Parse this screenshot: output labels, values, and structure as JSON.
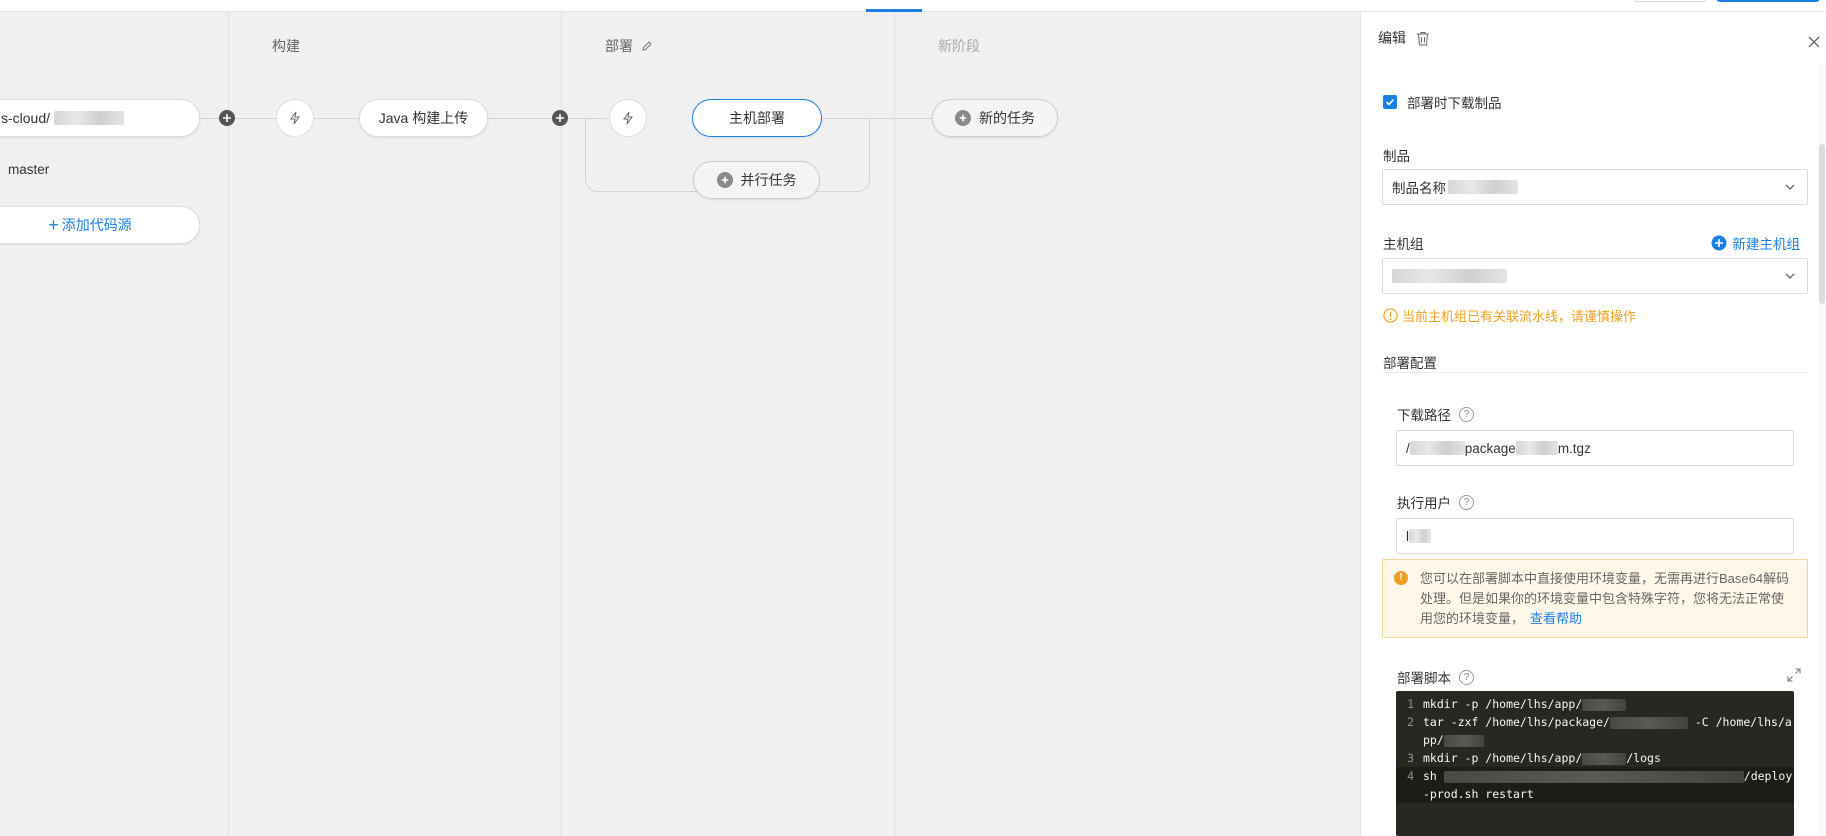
{
  "canvas": {
    "stages": [
      {
        "title": "构建"
      },
      {
        "title": "部署"
      },
      {
        "title": "新阶段"
      }
    ],
    "source": {
      "repo_prefix": "s-cloud/",
      "branch": "master",
      "add_source_label": "添加代码源"
    },
    "build": {
      "job_label": "Java 构建上传"
    },
    "deploy": {
      "job_label": "主机部署",
      "parallel_label": "并行任务"
    },
    "new_stage": {
      "new_job_label": "新的任务"
    }
  },
  "panel": {
    "title": "编辑",
    "download_checkbox_label": "部署时下载制品",
    "download_checked": true,
    "artifact": {
      "label": "制品",
      "value_prefix": "制品名称"
    },
    "host_group": {
      "label": "主机组",
      "new_label": "新建主机组",
      "warning": "当前主机组已有关联流水线，请谨慎操作"
    },
    "deploy_config_title": "部署配置",
    "download_path": {
      "label": "下载路径",
      "value_start": "/",
      "value_mid": "package",
      "value_end": "m.tgz"
    },
    "exec_user": {
      "label": "执行用户",
      "value_start": "l"
    },
    "alert": {
      "text": "您可以在部署脚本中直接使用环境变量，无需再进行Base64解码处理。但是如果你的环境变量中包含特殊字符，您将无法正常使用您的环境变量，",
      "link": "查看帮助"
    },
    "script": {
      "label": "部署脚本",
      "lines": [
        {
          "no": "1",
          "a": "mkdir -p /home/lhs/app/",
          "b": ""
        },
        {
          "no": "2",
          "a": "tar -zxf /home/lhs/package/",
          "b": " -C /home/lhs/app/"
        },
        {
          "no": "3",
          "a": "mkdir -p /home/lhs/app/",
          "b": "/logs"
        },
        {
          "no": "4",
          "a": "sh ",
          "b": "/deploy-prod.sh restart"
        }
      ]
    }
  },
  "colors": {
    "accent": "#1b7fe6",
    "warning": "#f0a020",
    "canvas_bg": "#f0f0f0",
    "code_bg": "#272822"
  }
}
